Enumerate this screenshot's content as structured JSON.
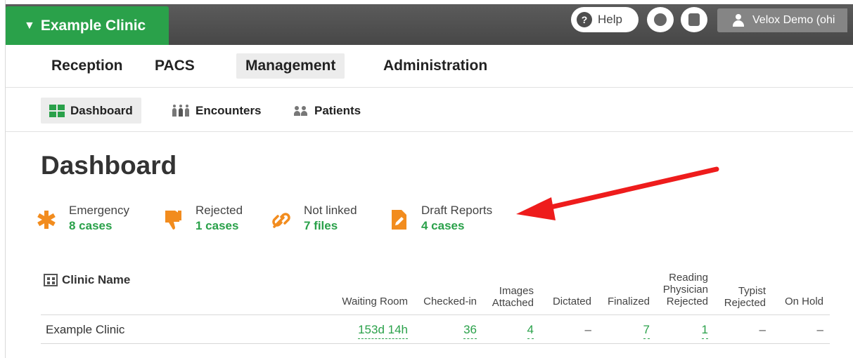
{
  "header": {
    "clinic_name": "Example Clinic",
    "help_label": "Help",
    "user_label": "Velox Demo (ohi"
  },
  "main_nav": [
    "Reception",
    "PACS",
    "Management",
    "Administration"
  ],
  "sub_nav": [
    "Dashboard",
    "Encounters",
    "Patients"
  ],
  "page_title": "Dashboard",
  "stats": [
    {
      "label": "Emergency",
      "value": "8 cases",
      "icon": "asterisk-icon"
    },
    {
      "label": "Rejected",
      "value": "1 cases",
      "icon": "thumbs-down-icon"
    },
    {
      "label": "Not linked",
      "value": "7 files",
      "icon": "link-icon"
    },
    {
      "label": "Draft Reports",
      "value": "4 cases",
      "icon": "edit-document-icon"
    }
  ],
  "table": {
    "name_header": "Clinic Name",
    "columns": [
      [
        "Waiting Room"
      ],
      [
        "Checked-in"
      ],
      [
        "Images",
        "Attached"
      ],
      [
        "Dictated"
      ],
      [
        "Finalized"
      ],
      [
        "Reading",
        "Physician",
        "Rejected"
      ],
      [
        "Typist",
        "Rejected"
      ],
      [
        "On Hold"
      ]
    ],
    "rows": [
      {
        "name": "Example Clinic",
        "values": [
          "153d 14h",
          "36",
          "4",
          "–",
          "7",
          "1",
          "–",
          "–"
        ]
      }
    ]
  },
  "colors": {
    "accent_green": "#2aa14a",
    "stat_orange": "#f28c1e",
    "arrow_red": "#ee1c1c",
    "topbar": "#4f4f4f"
  }
}
